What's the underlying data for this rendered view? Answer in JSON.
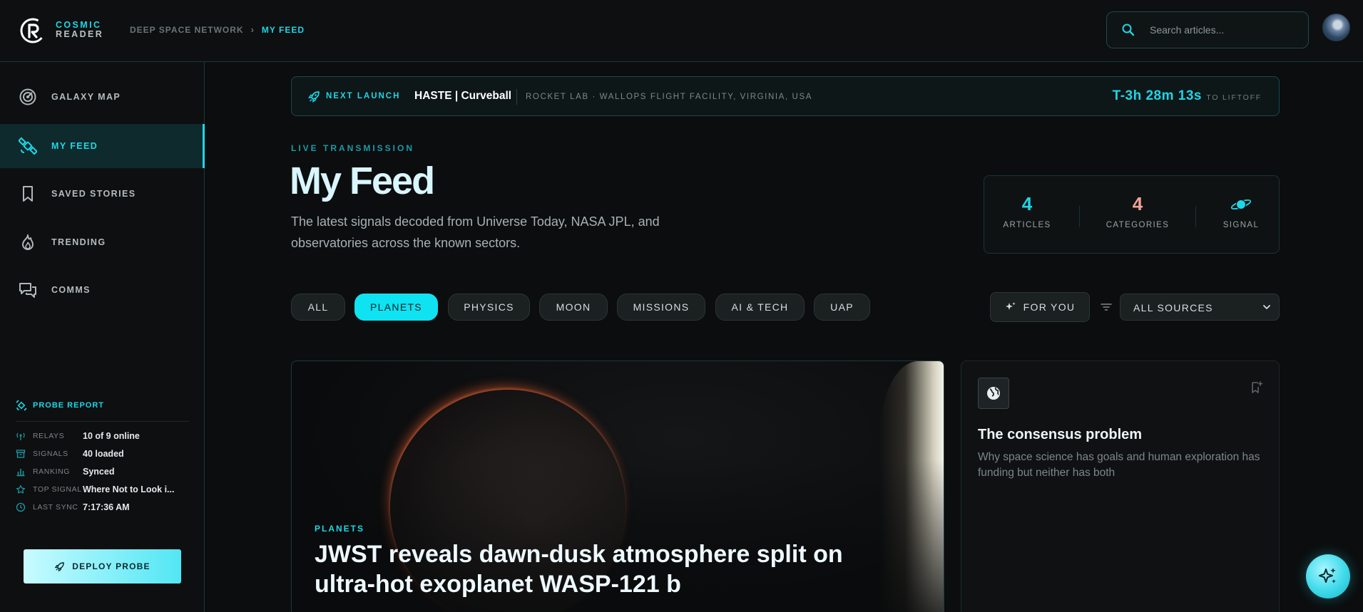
{
  "brand": {
    "line1": "COSMIC",
    "line2": "READER"
  },
  "breadcrumb": {
    "root": "DEEP SPACE NETWORK",
    "current": "MY FEED"
  },
  "search": {
    "placeholder": "Search articles..."
  },
  "sidebar": {
    "items": [
      {
        "label": "GALAXY MAP",
        "icon": "radar-icon"
      },
      {
        "label": "MY FEED",
        "icon": "satellite-icon",
        "active": true
      },
      {
        "label": "SAVED STORIES",
        "icon": "bookmark-icon"
      },
      {
        "label": "TRENDING",
        "icon": "flame-icon"
      },
      {
        "label": "COMMS",
        "icon": "chat-icon"
      }
    ],
    "probe_report": {
      "title": "PROBE REPORT",
      "rows": [
        {
          "key": "RELAYS",
          "value": "10 of 9 online",
          "icon": "antenna-icon"
        },
        {
          "key": "SIGNALS",
          "value": "40 loaded",
          "icon": "archive-icon"
        },
        {
          "key": "RANKING",
          "value": "Synced",
          "icon": "bar-chart-icon"
        },
        {
          "key": "TOP SIGNAL",
          "value": "Where Not to Look i...",
          "icon": "star-icon"
        },
        {
          "key": "LAST SYNC",
          "value": "7:17:36 AM",
          "icon": "clock-icon"
        }
      ]
    },
    "deploy_label": "DEPLOY PROBE"
  },
  "launch": {
    "label": "NEXT LAUNCH",
    "mission": "HASTE | Curveball",
    "location": "ROCKET LAB · WALLOPS FLIGHT FACILITY, VIRGINIA, USA",
    "countdown": "T-3h 28m 13s",
    "countdown_suffix": "TO LIFTOFF"
  },
  "header": {
    "eyebrow": "LIVE TRANSMISSION",
    "title": "My Feed",
    "subtitle": "The latest signals decoded from Universe Today, NASA JPL, and observatories across the known sectors."
  },
  "stats": {
    "articles": {
      "value": "4",
      "label": "ARTICLES",
      "color": "#1fd6e6"
    },
    "categories": {
      "value": "4",
      "label": "CATEGORIES",
      "color": "#f0a394"
    },
    "signal": {
      "label": "SIGNAL",
      "icon": "planet-icon"
    }
  },
  "filters": {
    "chips": [
      "ALL",
      "PLANETS",
      "PHYSICS",
      "MOON",
      "MISSIONS",
      "AI & TECH",
      "UAP"
    ],
    "active": "PLANETS",
    "for_you_label": "FOR YOU",
    "source_selected": "ALL SOURCES"
  },
  "hero_card": {
    "category": "PLANETS",
    "title": "JWST reveals dawn-dusk atmosphere split on ultra-hot exoplanet WASP-121 b"
  },
  "side_card": {
    "title": "The consensus problem",
    "description": "Why space science has goals and human exploration has funding but neither has both"
  },
  "colors": {
    "accent": "#1fd6e6",
    "background": "#0c0d0e",
    "coral": "#f0a394"
  }
}
